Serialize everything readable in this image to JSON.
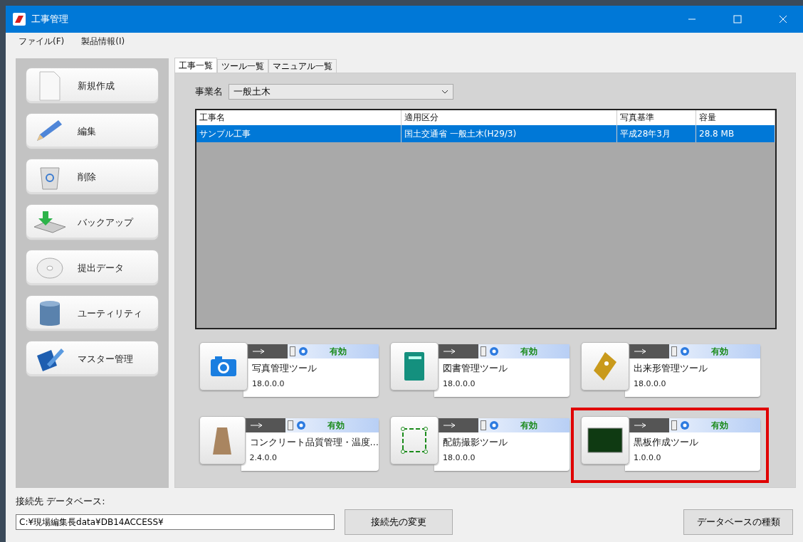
{
  "window": {
    "title": "工事管理"
  },
  "menu": [
    "ファイル(F)",
    "製品情報(I)"
  ],
  "sidebar": {
    "items": [
      {
        "label": "新規作成",
        "kind": "new"
      },
      {
        "label": "編集",
        "kind": "edit"
      },
      {
        "label": "削除",
        "kind": "delete"
      },
      {
        "label": "バックアップ",
        "kind": "backup"
      },
      {
        "label": "提出データ",
        "kind": "submit"
      },
      {
        "label": "ユーティリティ",
        "kind": "utility"
      },
      {
        "label": "マスター管理",
        "kind": "master"
      }
    ]
  },
  "tabs": [
    {
      "label": "工事一覧",
      "selected": true
    },
    {
      "label": "ツール一覧",
      "selected": false
    },
    {
      "label": "マニュアル一覧",
      "selected": false
    }
  ],
  "project_filter": {
    "label": "事業名",
    "value": "一般土木"
  },
  "table": {
    "columns": [
      "工事名",
      "適用区分",
      "写真基準",
      "容量"
    ],
    "rows": [
      {
        "cells": [
          "サンプル工事",
          "国土交通省 一般土木(H29/3)",
          "平成28年3月",
          "28.8 MB"
        ],
        "selected": true
      }
    ]
  },
  "tools": [
    {
      "name": "写真管理ツール",
      "version": "18.0.0.0",
      "status": "有効",
      "kind": "camera",
      "highlighted": false
    },
    {
      "name": "図書管理ツール",
      "version": "18.0.0.0",
      "status": "有効",
      "kind": "book",
      "highlighted": false
    },
    {
      "name": "出来形管理ツール",
      "version": "18.0.0.0",
      "status": "有効",
      "kind": "pen",
      "highlighted": false
    },
    {
      "name": "コンクリート品質管理・温度…",
      "version": "2.4.0.0",
      "status": "有効",
      "kind": "thimble",
      "highlighted": false
    },
    {
      "name": "配筋撮影ツール",
      "version": "18.0.0.0",
      "status": "有効",
      "kind": "rebar",
      "highlighted": false
    },
    {
      "name": "黒板作成ツール",
      "version": "1.0.0.0",
      "status": "有効",
      "kind": "blackboard",
      "highlighted": true
    }
  ],
  "connection": {
    "label": "接続先 データベース:",
    "path": "C:¥現場編集長data¥DB14ACCESS¥",
    "change_button": "接続先の変更",
    "db_type_button": "データベースの種類"
  }
}
